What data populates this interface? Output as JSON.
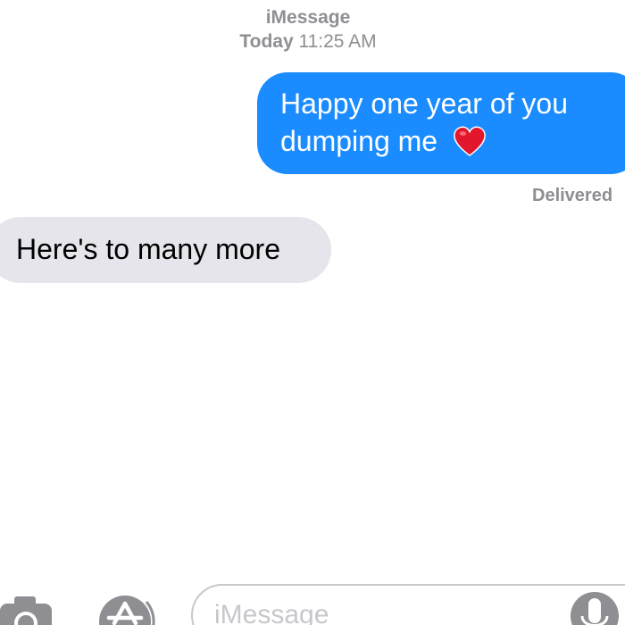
{
  "header": {
    "service": "iMessage",
    "day": "Today",
    "time": "11:25 AM"
  },
  "messages": [
    {
      "direction": "outgoing",
      "lines": [
        "Happy one year of you",
        "dumping me"
      ],
      "emoji": "red-heart",
      "bubble_color": "#1a8cff"
    },
    {
      "direction": "incoming",
      "text": "Here's to many more",
      "bubble_color": "#e6e5eb"
    }
  ],
  "status": {
    "delivered": "Delivered"
  },
  "input_bar": {
    "placeholder": "iMessage",
    "icons": [
      "camera-icon",
      "app-store-icon",
      "microphone-icon"
    ]
  },
  "colors": {
    "accent_blue": "#1a8cff",
    "muted_gray": "#8e8e93"
  }
}
